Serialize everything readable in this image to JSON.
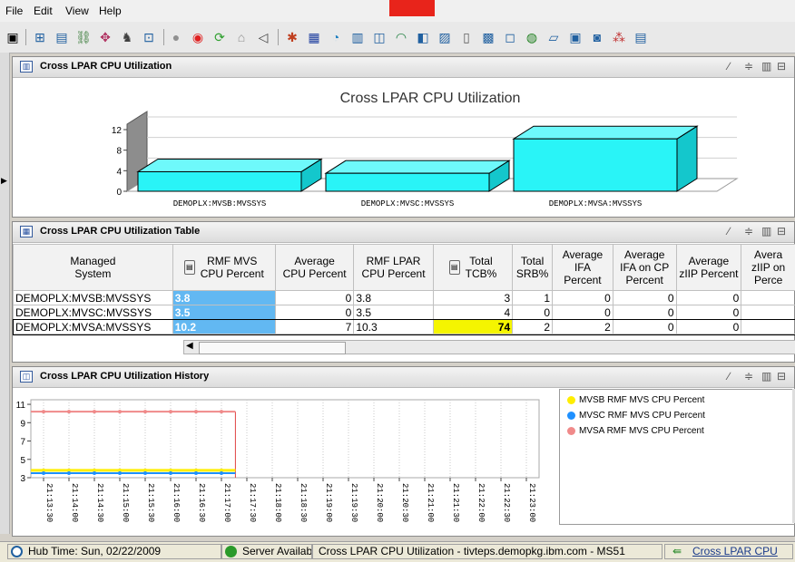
{
  "menu": {
    "file": "File",
    "edit": "Edit",
    "view": "View",
    "help": "Help"
  },
  "chart_panel": {
    "title": "Cross LPAR CPU Utilization",
    "chart_data": {
      "type": "bar",
      "title": "Cross LPAR CPU Utilization",
      "categories": [
        "DEMOPLX:MVSB:MVSSYS",
        "DEMOPLX:MVSC:MVSSYS",
        "DEMOPLX:MVSA:MVSSYS"
      ],
      "values": [
        3.8,
        3.5,
        10.2
      ],
      "yticks": [
        "0",
        "4",
        "8",
        "12"
      ],
      "ylim": [
        0,
        13
      ],
      "bar_color": "#29f4f7"
    }
  },
  "table_panel": {
    "title": "Cross LPAR CPU Utilization Table",
    "columns": [
      "Managed System",
      "RMF MVS CPU Percent",
      "Average CPU Percent",
      "RMF LPAR CPU Percent",
      "Total TCB%",
      "Total SRB%",
      "Average IFA Percent",
      "Average IFA on CP Percent",
      "Average zIIP Percent",
      "Average zIIP on CP Percent"
    ],
    "column_headers": [
      [
        "Managed",
        "System"
      ],
      [
        "RMF MVS",
        "CPU Percent"
      ],
      [
        "Average",
        "CPU Percent"
      ],
      [
        "RMF LPAR",
        "CPU Percent"
      ],
      [
        "Total",
        "TCB%"
      ],
      [
        "Total",
        "SRB%"
      ],
      [
        "Average",
        "IFA Percent"
      ],
      [
        "Average",
        "IFA on CP",
        "Percent"
      ],
      [
        "Average",
        "zIIP Percent"
      ],
      [
        "Avera",
        "zIIP on",
        "Perce"
      ]
    ],
    "rows": [
      [
        "DEMOPLX:MVSB:MVSSYS",
        "3.8",
        "0",
        "3.8",
        "3",
        "1",
        "0",
        "0",
        "0",
        ""
      ],
      [
        "DEMOPLX:MVSC:MVSSYS",
        "3.5",
        "0",
        "3.5",
        "4",
        "0",
        "0",
        "0",
        "0",
        ""
      ],
      [
        "DEMOPLX:MVSA:MVSSYS",
        "10.2",
        "7",
        "10.3",
        "74",
        "2",
        "2",
        "0",
        "0",
        ""
      ]
    ]
  },
  "history_panel": {
    "title": "Cross LPAR CPU Utilization History",
    "chart_data": {
      "type": "line",
      "yticks": [
        "3",
        "5",
        "7",
        "9",
        "11"
      ],
      "ylim": [
        3,
        11.5
      ],
      "x": [
        "21:13:30",
        "21:14:00",
        "21:14:30",
        "21:15:00",
        "21:15:30",
        "21:16:00",
        "21:16:30",
        "21:17:00",
        "21:17:30",
        "21:18:00",
        "21:18:30",
        "21:19:00",
        "21:19:30",
        "21:20:00",
        "21:20:30",
        "21:21:00",
        "21:21:30",
        "21:22:00",
        "21:22:30",
        "21:23:00"
      ],
      "series": [
        {
          "name": "MVSB RMF MVS CPU Percent",
          "color": "#ffee00",
          "values": [
            3.8,
            3.8,
            3.8,
            3.8,
            3.8,
            3.8,
            3.8,
            3.8
          ]
        },
        {
          "name": "MVSC RMF MVS CPU Percent",
          "color": "#1e90ff",
          "values": [
            3.5,
            3.5,
            3.5,
            3.5,
            3.5,
            3.5,
            3.5,
            3.5
          ]
        },
        {
          "name": "MVSA RMF MVS CPU Percent",
          "color": "#f08a8a",
          "values": [
            10.2,
            10.2,
            10.2,
            10.2,
            10.2,
            10.2,
            10.2,
            10.2
          ]
        }
      ]
    }
  },
  "status": {
    "hub_time": "Hub Time: Sun, 02/22/2009",
    "server": "Server Available",
    "workspace": "Cross LPAR CPU Utilization - tivteps.demopkg.ibm.com - MS51",
    "tab": "Cross LPAR CPU"
  }
}
